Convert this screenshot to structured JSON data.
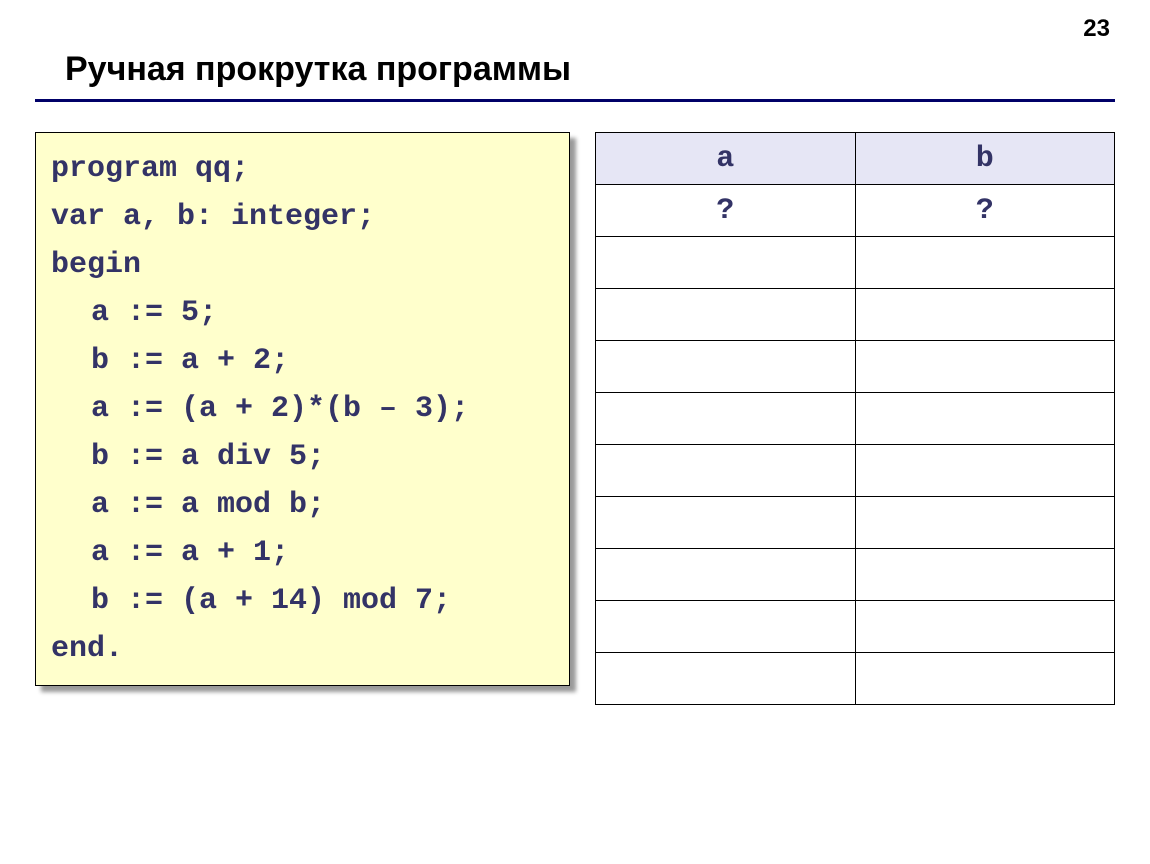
{
  "page_number": "23",
  "title": "Ручная прокрутка программы",
  "code": {
    "line1": "program qq;",
    "line2": "var a, b: integer;",
    "line3": "begin",
    "line4": "a := 5;",
    "line5": "b := a + 2;",
    "line6": "a := (a + 2)*(b – 3);",
    "line7": "b := a div 5;",
    "line8": "a := a mod b;",
    "line9": "a := a + 1;",
    "line10": "b := (a + 14) mod 7;",
    "line11": "end."
  },
  "table": {
    "headers": {
      "col1": "a",
      "col2": "b"
    },
    "rows": [
      {
        "a": "?",
        "b": "?"
      },
      {
        "a": "",
        "b": ""
      },
      {
        "a": "",
        "b": ""
      },
      {
        "a": "",
        "b": ""
      },
      {
        "a": "",
        "b": ""
      },
      {
        "a": "",
        "b": ""
      },
      {
        "a": "",
        "b": ""
      },
      {
        "a": "",
        "b": ""
      },
      {
        "a": "",
        "b": ""
      },
      {
        "a": "",
        "b": ""
      }
    ]
  }
}
